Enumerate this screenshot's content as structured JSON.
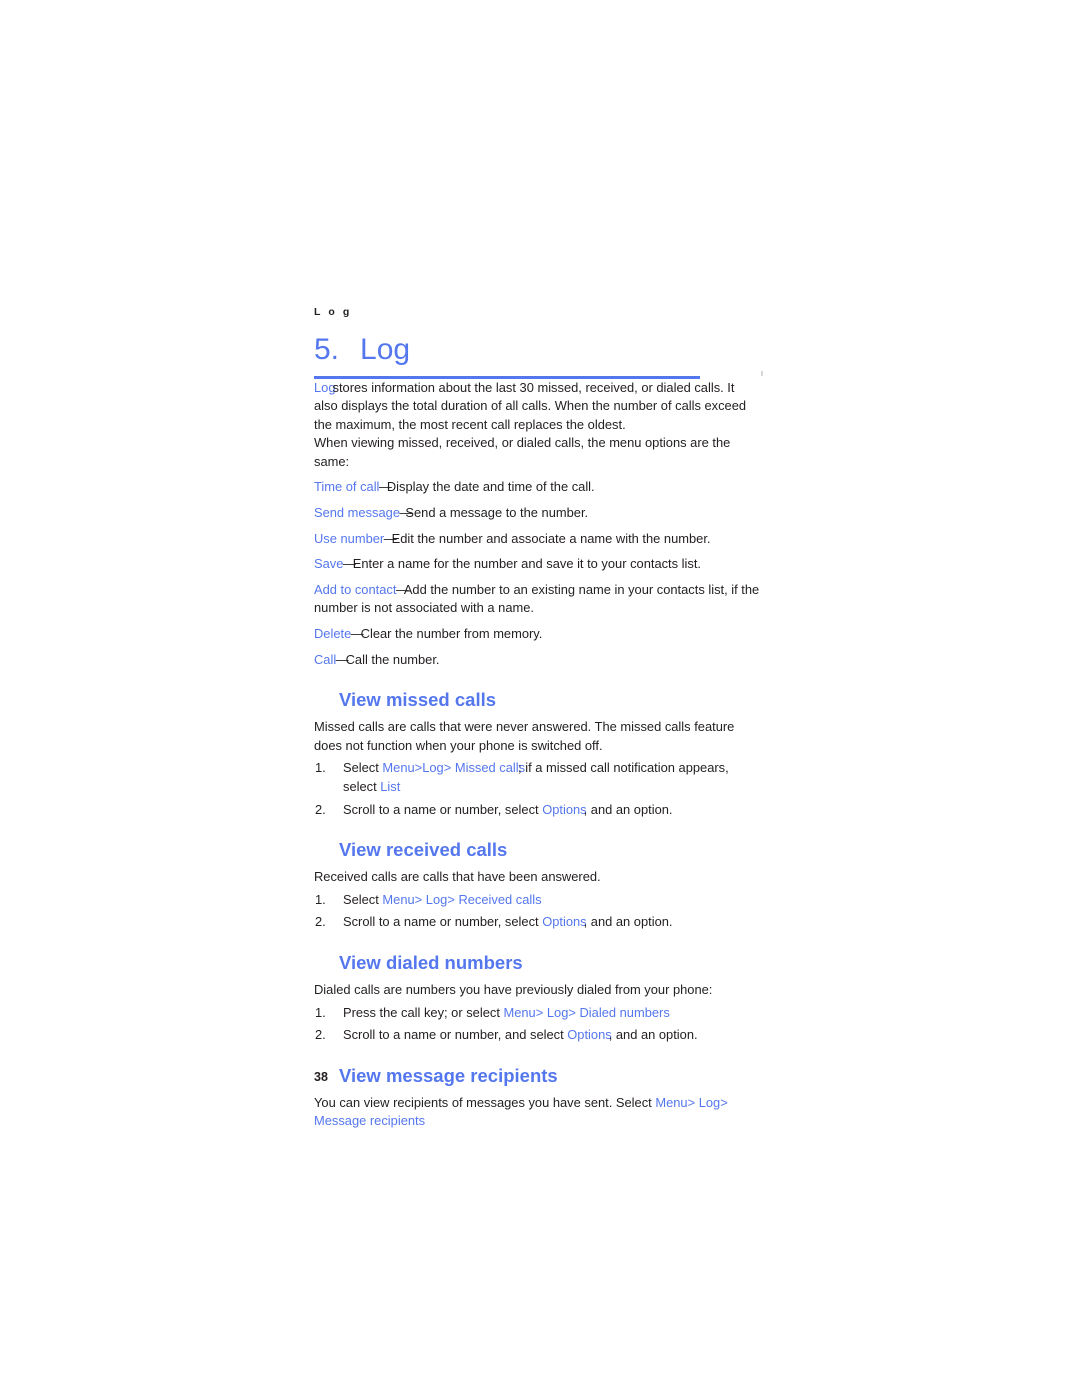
{
  "document": {
    "running_header": "L o g",
    "chapter_number": "5.",
    "chapter_title": "Log",
    "page_number": "38"
  },
  "intro": {
    "term": "Log",
    "text": "stores information about the last 30 missed, received, or dialed calls. It also displays the total duration of all calls. When the number of calls exceed the maximum, the most recent call replaces the oldest."
  },
  "menu_options_lead": "When viewing missed, received, or dialed calls, the menu options are the same:",
  "menu_options": [
    {
      "term": "Time of call",
      "dash": "—",
      "description": "Display the date and time of the call."
    },
    {
      "term": "Send message",
      "dash": "—",
      "description": "Send a message to the number."
    },
    {
      "term": "Use number",
      "dash": "—",
      "description": "Edit the number and associate a name with the number."
    },
    {
      "term": "Save",
      "dash": "—",
      "description": "Enter a name for the number and save it to your contacts list."
    },
    {
      "term": "Add to contact",
      "dash": "—",
      "description": "Add the number to an existing name in your contacts list, if the number is not associated with a name."
    },
    {
      "term": "Delete",
      "dash": "—",
      "description": "Clear the number from memory."
    },
    {
      "term": "Call",
      "dash": "—",
      "description": "Call the number."
    }
  ],
  "sections": {
    "missed": {
      "heading": "View missed calls",
      "intro": "Missed calls are calls that were never answered. The missed calls feature does not function when your phone is switched off.",
      "steps": [
        {
          "num": "1.",
          "lead": "Select ",
          "path": [
            "Menu",
            "Log",
            "Missed calls"
          ],
          "separator": ">",
          "tail": "; if a missed call notification appears, select ",
          "tail_link": "List"
        },
        {
          "num": "2.",
          "lead": "Scroll to a name or number, select ",
          "link": "Options",
          "tail": ", and an option."
        }
      ]
    },
    "received": {
      "heading": "View received calls",
      "intro": "Received calls are calls that have been answered.",
      "steps": [
        {
          "num": "1.",
          "lead": "Select ",
          "path": [
            "Menu",
            "Log",
            "Received calls"
          ],
          "separator": ">"
        },
        {
          "num": "2.",
          "lead": "Scroll to a name or number, select ",
          "link": "Options",
          "tail": ", and an option."
        }
      ]
    },
    "dialed": {
      "heading": "View dialed numbers",
      "intro": "Dialed calls are numbers you have previously dialed from your phone:",
      "steps": [
        {
          "num": "1.",
          "lead": "Press the call key; or select ",
          "path": [
            "Menu",
            "Log",
            "Dialed numbers"
          ],
          "separator": ">"
        },
        {
          "num": "2.",
          "lead": "Scroll to a name or number, and select ",
          "link": "Options",
          "tail": ", and an option."
        }
      ]
    },
    "recipients": {
      "heading": "View message recipients",
      "lead": "You can view recipients of messages you have sent. Select ",
      "path": [
        "Menu",
        "Log"
      ],
      "separator": ">",
      "final_link": "Message recipients"
    }
  }
}
